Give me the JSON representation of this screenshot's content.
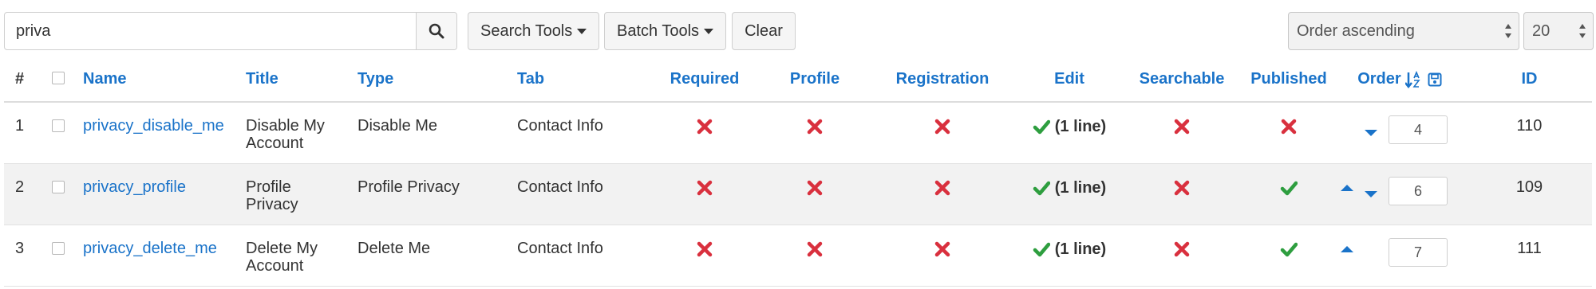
{
  "toolbar": {
    "search_value": "priva",
    "search_tools": "Search Tools",
    "batch_tools": "Batch Tools",
    "clear": "Clear",
    "order_select": "Order ascending",
    "limit_select": "20"
  },
  "columns": {
    "num": "#",
    "name": "Name",
    "title": "Title",
    "type": "Type",
    "tab": "Tab",
    "required": "Required",
    "profile": "Profile",
    "registration": "Registration",
    "edit": "Edit",
    "searchable": "Searchable",
    "published": "Published",
    "order": "Order",
    "id": "ID"
  },
  "rows": [
    {
      "num": "1",
      "name": "privacy_disable_me",
      "title_line1": "Disable My",
      "title_line2": "Account",
      "type": "Disable Me",
      "tab": "Contact Info",
      "edit": "(1 line)",
      "order": "4",
      "id": "110"
    },
    {
      "num": "2",
      "name": "privacy_profile",
      "title_line1": "Profile",
      "title_line2": "Privacy",
      "type": "Profile Privacy",
      "tab": "Contact Info",
      "edit": "(1 line)",
      "order": "6",
      "id": "109"
    },
    {
      "num": "3",
      "name": "privacy_delete_me",
      "title_line1": "Delete My",
      "title_line2": "Account",
      "type": "Delete Me",
      "tab": "Contact Info",
      "edit": "(1 line)",
      "order": "7",
      "id": "111"
    }
  ],
  "colors": {
    "link": "#1a73c9",
    "cross": "#d9303e",
    "check": "#2e9e3f",
    "row_alt": "#f2f2f2"
  }
}
